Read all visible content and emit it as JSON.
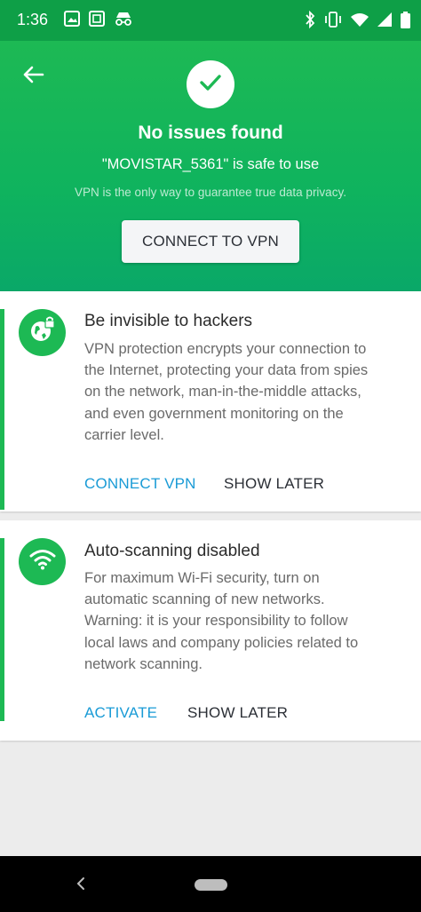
{
  "status_bar": {
    "time": "1:36",
    "left_icons": [
      "gallery-icon",
      "screenshot-icon",
      "incognito-icon"
    ],
    "right_icons": [
      "bluetooth-icon",
      "vibrate-icon",
      "wifi-icon",
      "signal-icon",
      "battery-icon"
    ]
  },
  "header": {
    "title": "No issues found",
    "subtitle": "\"MOVISTAR_5361\" is safe to use",
    "note": "VPN is the only way to guarantee true data privacy.",
    "connect_button": "CONNECT TO VPN",
    "icons": {
      "back": "back-arrow-icon",
      "status": "checkmark-icon"
    }
  },
  "cards": [
    {
      "icon": "globe-lock-icon",
      "title": "Be invisible to hackers",
      "body": [
        "VPN protection encrypts your connection to",
        "the Internet, protecting your data from spies",
        "on the network, man-in-the-middle attacks,",
        "and even government monitoring on the",
        "carrier level."
      ],
      "primary_action": "CONNECT VPN",
      "secondary_action": "SHOW LATER"
    },
    {
      "icon": "wifi-icon",
      "title": "Auto-scanning disabled",
      "body": [
        "For maximum Wi-Fi security, turn on",
        "automatic scanning of new networks.",
        "Warning: it is your responsibility to follow",
        "local laws and company policies related to",
        "network scanning."
      ],
      "primary_action": "ACTIVATE",
      "secondary_action": "SHOW LATER"
    }
  ],
  "colors": {
    "accent_green": "#1db954",
    "status_bar": "#0e9f47",
    "link_blue": "#1a9bd6"
  }
}
